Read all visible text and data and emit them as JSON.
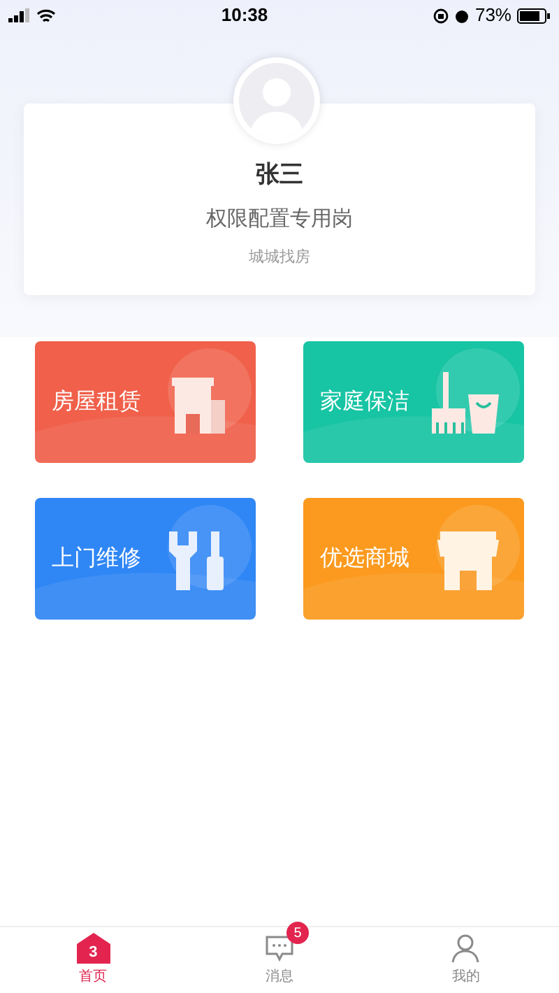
{
  "status_bar": {
    "time": "10:38",
    "battery": "73%"
  },
  "profile": {
    "name": "张三",
    "role": "权限配置专用岗",
    "company": "城城找房"
  },
  "services": [
    {
      "label": "房屋租赁",
      "kind": "house",
      "color": "#f0604a"
    },
    {
      "label": "家庭保洁",
      "kind": "cleaning",
      "color": "#17c4a4"
    },
    {
      "label": "上门维修",
      "kind": "repair",
      "color": "#2f86f5"
    },
    {
      "label": "优选商城",
      "kind": "shop",
      "color": "#fb9a1e"
    }
  ],
  "tabs": [
    {
      "label": "首页",
      "kind": "home",
      "icon_text": "3",
      "selected": true
    },
    {
      "label": "消息",
      "kind": "message",
      "badge": "5",
      "selected": false
    },
    {
      "label": "我的",
      "kind": "profile",
      "selected": false
    }
  ]
}
